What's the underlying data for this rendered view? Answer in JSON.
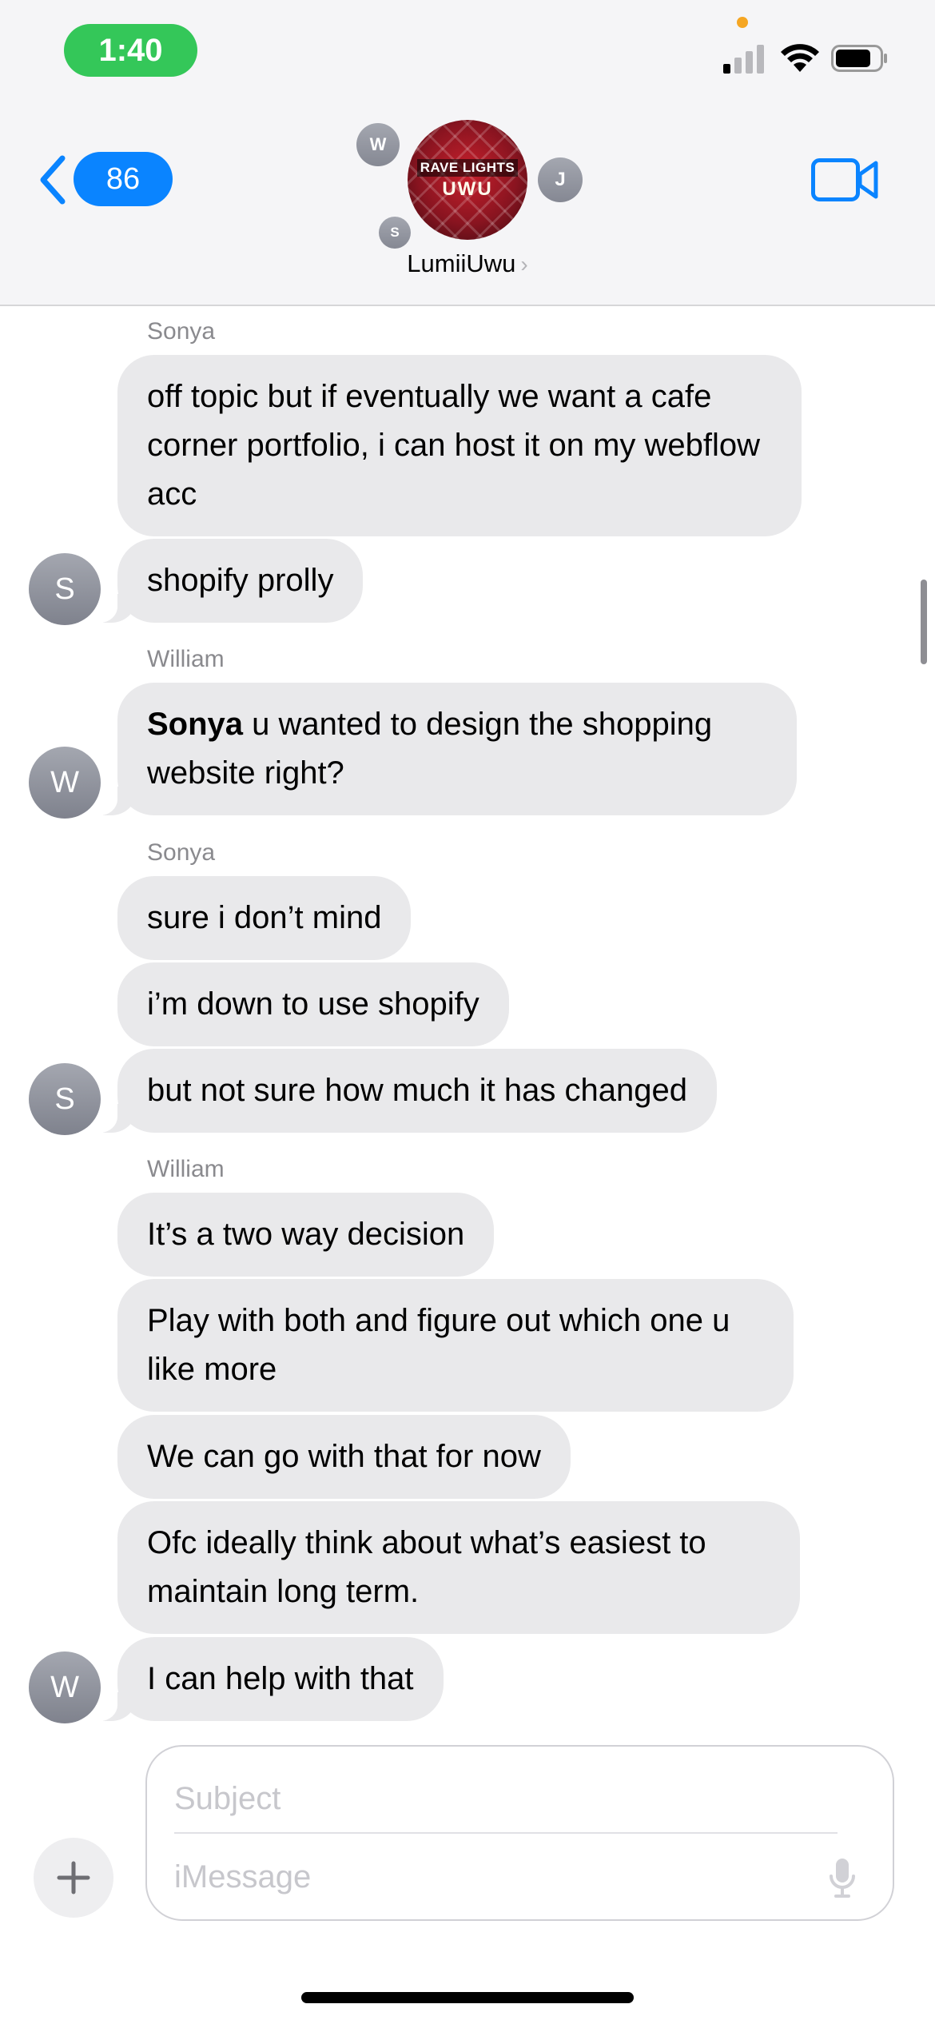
{
  "status_bar": {
    "time": "1:40"
  },
  "header": {
    "back_count": "86",
    "group_name": "LumiiUwu",
    "group_avatar_line1": "RAVE LIGHTS",
    "group_avatar_line2": "UWU",
    "member_initials": [
      "W",
      "J",
      "S"
    ],
    "accent_color": "#0a84ff"
  },
  "messages": [
    {
      "sender": "Sonya",
      "text": "off topic but if eventually we want a cafe corner portfolio, i can host it on my webflow acc"
    },
    {
      "text": "shopify prolly",
      "avatar": "S"
    },
    {
      "sender": "William",
      "mention": "Sonya",
      "text": " u wanted to design the shopping website right?",
      "avatar": "W"
    },
    {
      "sender": "Sonya",
      "text": "sure i don’t mind"
    },
    {
      "text": "i’m down to use shopify"
    },
    {
      "text": "but not sure how much it has changed",
      "avatar": "S"
    },
    {
      "sender": "William",
      "text": "It’s a two way decision"
    },
    {
      "text": "Play with both and figure out which one u like more"
    },
    {
      "text": "We can go with that for now"
    },
    {
      "text": "Ofc ideally think about what’s easiest to maintain long term."
    },
    {
      "text": "I can help with that",
      "avatar": "W"
    }
  ],
  "composer": {
    "subject_placeholder": "Subject",
    "message_placeholder": "iMessage"
  },
  "icons": [
    "chevron-left-icon",
    "video-camera-icon",
    "plus-icon",
    "microphone-icon",
    "signal-icon",
    "wifi-icon",
    "battery-icon"
  ]
}
